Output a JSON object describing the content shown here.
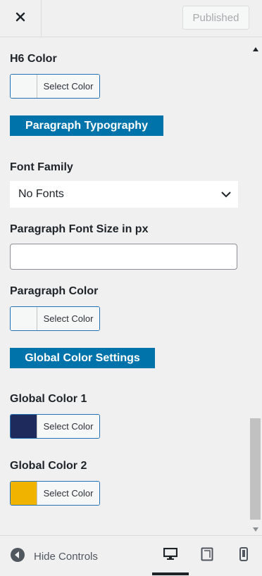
{
  "header": {
    "close_icon": "close-icon",
    "published_label": "Published"
  },
  "controls": {
    "h6_color": {
      "label": "H6 Color",
      "button_label": "Select Color",
      "value": "#f6f7f7"
    },
    "paragraph_heading": "Paragraph Typography",
    "font_family": {
      "label": "Font Family",
      "selected": "No Fonts"
    },
    "paragraph_font_size": {
      "label": "Paragraph Font Size in px",
      "value": ""
    },
    "paragraph_color": {
      "label": "Paragraph Color",
      "button_label": "Select Color",
      "value": "#f6f7f7"
    },
    "global_heading": "Global Color Settings",
    "global_color_1": {
      "label": "Global Color 1",
      "button_label": "Select Color",
      "value": "#1f2a5c"
    },
    "global_color_2": {
      "label": "Global Color 2",
      "button_label": "Select Color",
      "value": "#f0b400"
    }
  },
  "footer": {
    "hide_controls_label": "Hide Controls",
    "devices": [
      "desktop",
      "tablet",
      "mobile"
    ],
    "active_device": "desktop"
  },
  "colors": {
    "accent": "#0073aa",
    "focus_border": "#2271b1"
  }
}
